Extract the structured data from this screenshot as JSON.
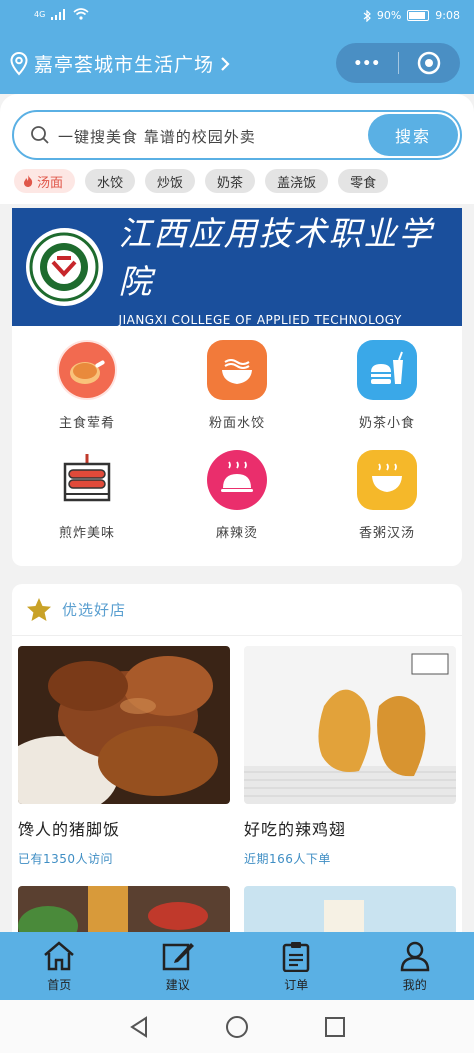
{
  "status_bar": {
    "network": "4G",
    "battery": "90%",
    "time": "9:08"
  },
  "nav": {
    "location": "嘉亭荟城市生活广场",
    "menu_dots": "•••"
  },
  "search": {
    "placeholder": "一键搜美食 靠谱的校园外卖",
    "button_label": "搜索"
  },
  "tags": [
    "汤面",
    "水饺",
    "炒饭",
    "奶茶",
    "盖浇饭",
    "零食"
  ],
  "banner": {
    "title_cn": "江西应用技术职业学院",
    "title_en": "JIANGXI COLLEGE OF APPLIED TECHNOLOGY"
  },
  "categories": [
    {
      "label": "主食荤肴",
      "icon": "roast-chicken-icon",
      "color": "#f26a50"
    },
    {
      "label": "粉面水饺",
      "icon": "noodle-bowl-icon",
      "color": "#f27a3a"
    },
    {
      "label": "奶茶小食",
      "icon": "burger-drink-icon",
      "color": "#3aa8e8"
    },
    {
      "label": "煎炸美味",
      "icon": "sausage-grill-icon",
      "color": "#e04a3a"
    },
    {
      "label": "麻辣烫",
      "icon": "cloche-icon",
      "color": "#ea2e6c"
    },
    {
      "label": "香粥汉汤",
      "icon": "soup-bowl-icon",
      "color": "#f5b82a"
    }
  ],
  "featured": {
    "title": "优选好店",
    "shops": [
      {
        "name": "馋人的猪脚饭",
        "meta": "已有1350人访问"
      },
      {
        "name": "好吃的辣鸡翅",
        "meta": "近期166人下单"
      }
    ]
  },
  "tab_bar": {
    "items": [
      {
        "label": "首页",
        "icon": "home-icon"
      },
      {
        "label": "建议",
        "icon": "edit-icon"
      },
      {
        "label": "订单",
        "icon": "clipboard-icon"
      },
      {
        "label": "我的",
        "icon": "user-icon"
      }
    ]
  }
}
